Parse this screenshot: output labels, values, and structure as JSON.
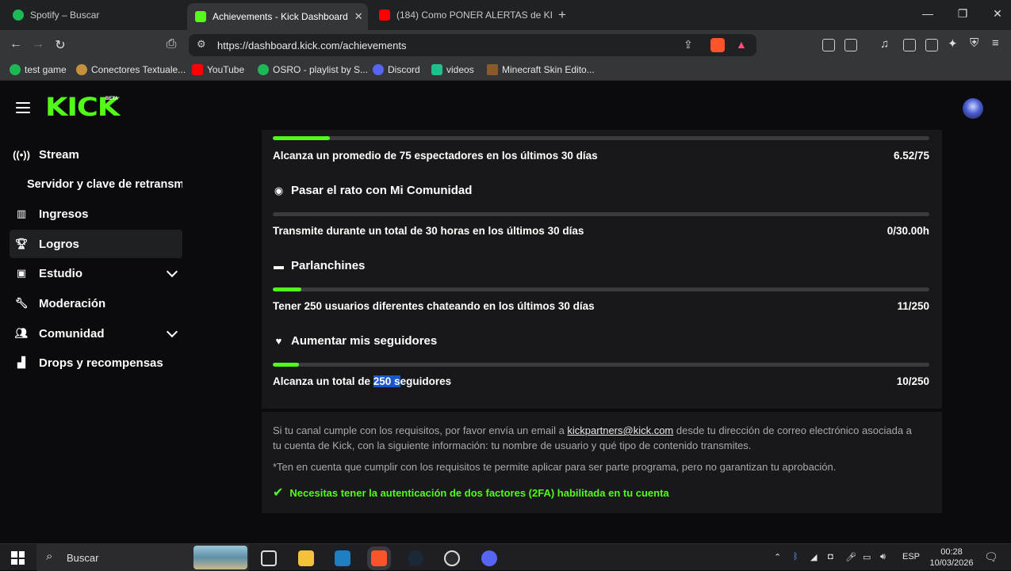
{
  "browser": {
    "tabs": [
      {
        "title": "Spotify – Buscar",
        "active": false
      },
      {
        "title": "Achievements - Kick Dashboard",
        "active": true
      },
      {
        "title": "(184) Como PONER ALERTAS de KICK",
        "active": false
      }
    ],
    "new_tab": "+",
    "url": "https://dashboard.kick.com/achievements",
    "bookmarks": [
      "test game",
      "Conectores Textuale...",
      "YouTube",
      "OSRO - playlist by S...",
      "Discord",
      "videos",
      "Minecraft Skin Edito..."
    ]
  },
  "kick": {
    "logo": "KICK",
    "logo_badge": "BETA",
    "sidebar": [
      {
        "label": "Stream",
        "icon": "broadcast-icon",
        "active": false,
        "expandable": false
      },
      {
        "label": "Servidor y clave de retransm",
        "icon": "",
        "active": false,
        "expandable": false
      },
      {
        "label": "Ingresos",
        "icon": "chart-icon",
        "active": false,
        "expandable": false
      },
      {
        "label": "Logros",
        "icon": "trophy-icon",
        "active": true,
        "expandable": false
      },
      {
        "label": "Estudio",
        "icon": "studio-icon",
        "active": false,
        "expandable": true
      },
      {
        "label": "Moderación",
        "icon": "wrench-icon",
        "active": false,
        "expandable": false
      },
      {
        "label": "Comunidad",
        "icon": "community-icon",
        "active": false,
        "expandable": true
      },
      {
        "label": "Drops y recompensas",
        "icon": "drops-icon",
        "active": false,
        "expandable": false
      }
    ],
    "achievements": {
      "top_requirement": {
        "text": "Alcanza un promedio de 75 espectadores en los últimos 30 días",
        "progress": "6.52/75",
        "fraction": 0.087
      },
      "items": [
        {
          "title": "Pasar el rato con Mi Comunidad",
          "icon": "broadcast-icon",
          "requirement": "Transmite durante un total de 30 horas en los últimos 30 días",
          "progress": "0/30.00h",
          "fraction": 0.0
        },
        {
          "title": "Parlanchines",
          "icon": "chat-icon",
          "requirement": "Tener 250 usuarios diferentes chateando en los últimos 30 días",
          "progress": "11/250",
          "fraction": 0.044
        },
        {
          "title": "Aumentar mis seguidores",
          "icon": "heart-icon",
          "requirement_before": "Alcanza un total de ",
          "requirement_highlight": "250 s",
          "requirement_after": "eguidores",
          "progress": "10/250",
          "fraction": 0.04
        }
      ]
    },
    "info": {
      "line1_before": "Si tu canal cumple con los requisitos, por favor envía un email a ",
      "email": "kickpartners@kick.com",
      "line1_after": " desde tu dirección de correo electrónico asociada a tu cuenta de Kick, con la siguiente información: tu nombre de usuario y qué tipo de contenido transmites.",
      "disclaimer": "*Ten en cuenta que cumplir con los requisitos te permite aplicar para ser parte programa, pero no garantizan tu aprobación.",
      "twofa": "Necesitas tener la autenticación de dos factores (2FA) habilitada en tu cuenta"
    }
  },
  "taskbar": {
    "search_placeholder": "Buscar",
    "language": "ESP",
    "time": "00:28",
    "date": "10/03/2026"
  },
  "colors": {
    "accent": "#53fc18",
    "panel": "#18181b",
    "background": "#0b0b0d",
    "highlight": "#1a56c9"
  }
}
